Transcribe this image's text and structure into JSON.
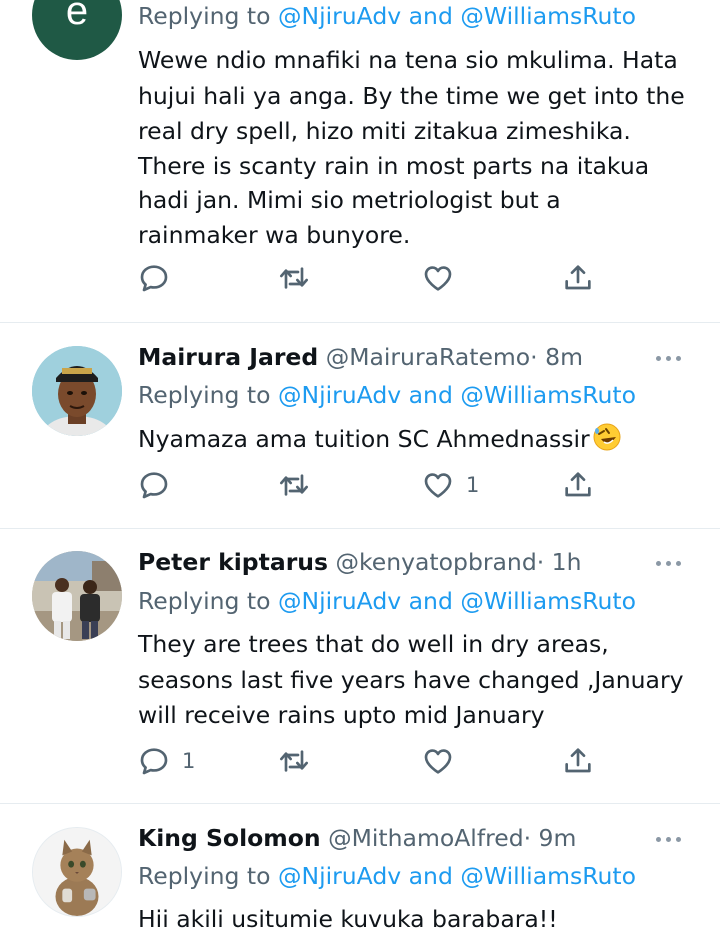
{
  "tweets": [
    {
      "avatar_letter": "e",
      "replying_label": "Replying to",
      "mention_1": "@NjiruAdv",
      "and_label": "and",
      "mention_2": "@WilliamsRuto",
      "text_lines": [
        "Wewe ndio mnafiki na tena sio mkulima. Hata",
        "hujui hali ya anga. By the time we get into the",
        "real dry spell, hizo miti zitakua zimeshika.",
        "There is scanty rain in most parts na itakua",
        "hadi jan. Mimi sio metriologist but a",
        "rainmaker wa bunyore."
      ],
      "reply_count": "",
      "like_count": ""
    },
    {
      "name": "Mairura Jared",
      "handle": "@MairuraRatemo",
      "time": "· 8m",
      "replying_label": "Replying to",
      "mention_1": "@NjiruAdv",
      "and_label": "and",
      "mention_2": "@WilliamsRuto",
      "text_lines": [
        "Nyamaza ama tuition SC Ahmednassir"
      ],
      "reply_count": "",
      "like_count": "1"
    },
    {
      "name": "Peter kiptarus",
      "handle": "@kenyatopbrand",
      "time": "· 1h",
      "replying_label": "Replying to",
      "mention_1": "@NjiruAdv",
      "and_label": "and",
      "mention_2": "@WilliamsRuto",
      "text_lines": [
        "They are trees that do well in dry areas,",
        "seasons last five years have changed ,January",
        "will receive  rains upto mid January"
      ],
      "reply_count": "1",
      "like_count": ""
    },
    {
      "name": "King Solomon",
      "handle": "@MithamoAlfred",
      "time": "· 9m",
      "replying_label": "Replying to",
      "mention_1": "@NjiruAdv",
      "and_label": "and",
      "mention_2": "@WilliamsRuto",
      "text_lines": [
        "Hii akili usitumie kuvuka barabara!!"
      ]
    }
  ],
  "icons": {
    "reply": "reply-icon",
    "retweet": "retweet-icon",
    "like": "like-icon",
    "share": "share-icon",
    "more": "more-icon",
    "emoji": "rolling-on-floor-laughing-emoji"
  },
  "colors": {
    "accent": "#1d9bf0",
    "secondary_text": "#536471",
    "icon": "#536471",
    "divider": "#e6ecf0",
    "avatar_e": "#1f5945"
  }
}
